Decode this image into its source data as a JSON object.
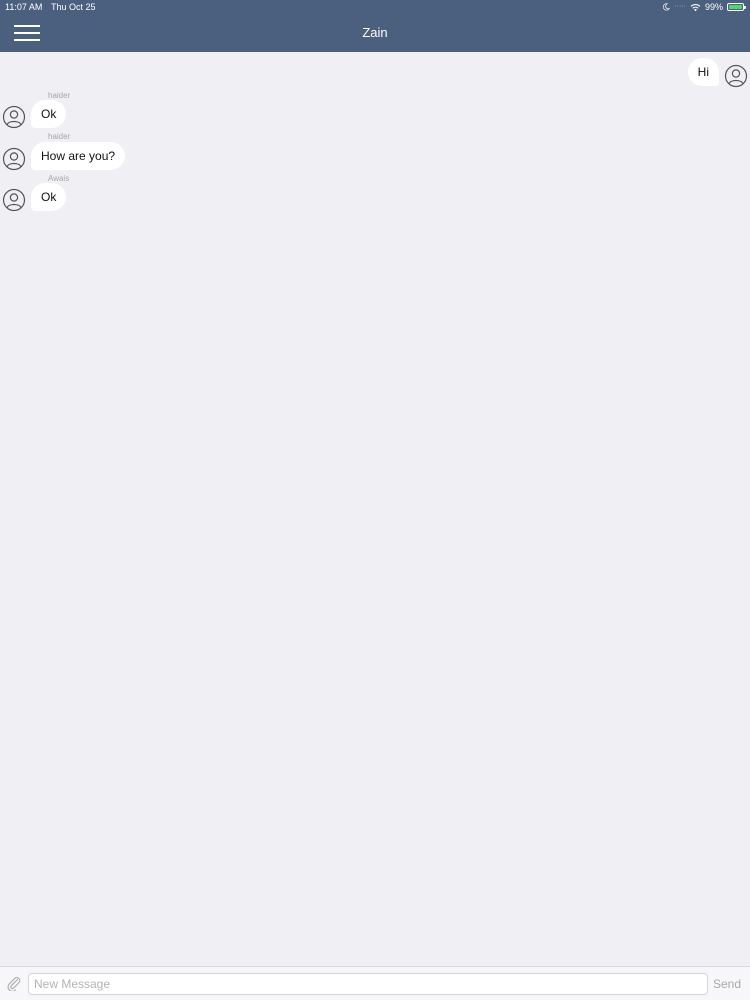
{
  "status_bar": {
    "time": "11:07 AM",
    "date": "Thu Oct 25",
    "battery": "99%",
    "icons": [
      "moon-icon",
      "wifi-icon",
      "battery-icon"
    ],
    "battery_color": "#4cd964"
  },
  "nav": {
    "title": "Zain",
    "menu_icon": "hamburger-menu-icon",
    "background": "#4b5f7e"
  },
  "messages": [
    {
      "direction": "outgoing",
      "sender": "",
      "text": "Hi"
    },
    {
      "direction": "incoming",
      "sender": "haider",
      "text": "Ok"
    },
    {
      "direction": "incoming",
      "sender": "haider",
      "text": "How are you?"
    },
    {
      "direction": "incoming",
      "sender": "Awais",
      "text": "Ok"
    }
  ],
  "composer": {
    "placeholder": "New Message",
    "value": "",
    "send_label": "Send",
    "attach_icon": "paperclip-icon"
  },
  "colors": {
    "chat_background": "#efeff4",
    "bubble": "#ffffff"
  }
}
